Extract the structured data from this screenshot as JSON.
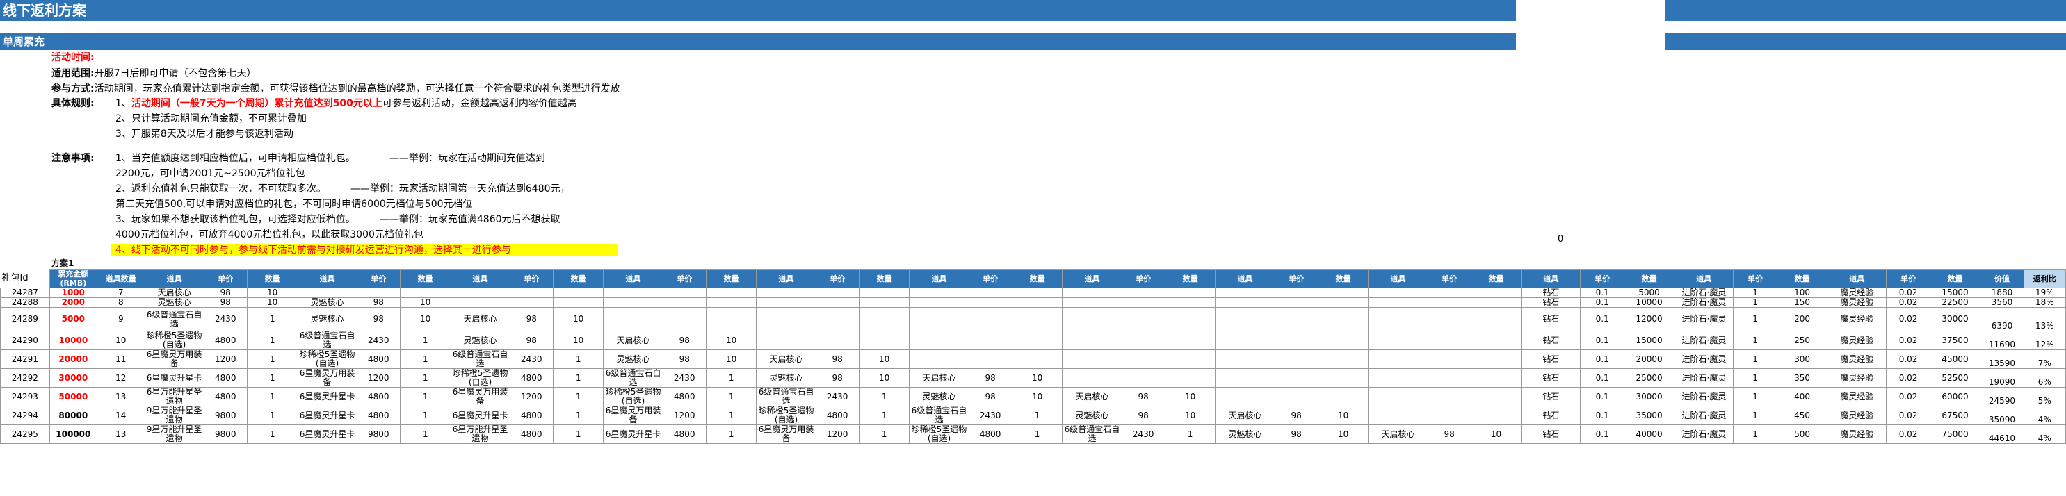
{
  "title": "线下返利方案",
  "subtitle": "单周累充",
  "notes": {
    "time_label": "活动时间:",
    "scope_label": "适用范围:",
    "scope_text": "开服7日后即可申请（不包含第七天）",
    "method_label": "参与方式:",
    "method_text": "活动期间，玩家充值累计达到指定金额，可获得该档位达到的最高档的奖励，可选择任意一个符合要求的礼包类型进行发放",
    "rules_label": "具体规则:",
    "rule1_prefix": "1、",
    "rule1_red": "活动期间（一般7天为一个周期）累计充值达到500元以上",
    "rule1_rest": "可参与返利活动，金额越高返利内容价值越高",
    "rule2": "2、只计算活动期间充值金额，不可累计叠加",
    "rule3": "3、开服第8天及以后才能参与该返利活动",
    "attention_label": "注意事项:",
    "att1a": "1、当充值额度达到相应档位后，可申请相应档位礼包。　　　　——举例：玩家在活动期间充值达到",
    "att1b": "2200元，可申请2001元~2500元档位礼包",
    "att2a": "2、返利充值礼包只能获取一次，不可获取多次。　　　——举例：玩家活动期间第一天充值达到6480元，",
    "att2b": "第二天充值500,可以申请对应档位的礼包，不可同时申请6000元档位与500元档位",
    "att3a": "3、玩家如果不想获取该档位礼包，可选择对应低档位。　　　——举例：玩家充值满4860元后不想获取",
    "att3b": "4000元档位礼包，可放弃4000元档位礼包，以此获取3000元档位礼包",
    "att4": "4、线下活动不可同时参与，参与线下活动前需与对接研发运营进行沟通，选择其一进行参与"
  },
  "stray_zero": "0",
  "plan_label": "方案1",
  "header": {
    "id": "礼包Id",
    "amount": "累充金额(RMB)",
    "count": "道具数量",
    "item": "道具",
    "price": "单价",
    "qty": "数量",
    "value": "价值",
    "ratio": "返利比"
  },
  "rows": [
    {
      "id": "24287",
      "amount": "1000",
      "red": true,
      "count": "7",
      "groups": [
        [
          "天启核心",
          "98",
          "10"
        ],
        [
          "",
          "",
          ""
        ],
        [
          "",
          "",
          ""
        ],
        [
          "",
          "",
          ""
        ],
        [
          "",
          "",
          ""
        ],
        [
          "",
          "",
          ""
        ],
        [
          "",
          "",
          ""
        ],
        [
          "",
          "",
          ""
        ],
        [
          "",
          "",
          ""
        ]
      ],
      "tail": [
        "钻石",
        "0.1",
        "5000",
        "进阶石·魔灵",
        "1",
        "100",
        "魔灵经验",
        "0.02",
        "15000"
      ],
      "value": "1880",
      "ratio": "19%"
    },
    {
      "id": "24288",
      "amount": "2000",
      "red": true,
      "count": "8",
      "groups": [
        [
          "灵魅核心",
          "98",
          "10"
        ],
        [
          "灵魅核心",
          "98",
          "10"
        ],
        [
          "",
          "",
          ""
        ],
        [
          "",
          "",
          ""
        ],
        [
          "",
          "",
          ""
        ],
        [
          "",
          "",
          ""
        ],
        [
          "",
          "",
          ""
        ],
        [
          "",
          "",
          ""
        ],
        [
          "",
          "",
          ""
        ]
      ],
      "tail": [
        "钻石",
        "0.1",
        "10000",
        "进阶石·魔灵",
        "1",
        "150",
        "魔灵经验",
        "0.02",
        "22500"
      ],
      "value": "3560",
      "ratio": "18%"
    },
    {
      "id": "24289",
      "amount": "5000",
      "red": true,
      "count": "9",
      "groups": [
        [
          "6级普通宝石自选",
          "2430",
          "1"
        ],
        [
          "灵魅核心",
          "98",
          "10"
        ],
        [
          "天启核心",
          "98",
          "10"
        ],
        [
          "",
          "",
          ""
        ],
        [
          "",
          "",
          ""
        ],
        [
          "",
          "",
          ""
        ],
        [
          "",
          "",
          ""
        ],
        [
          "",
          "",
          ""
        ],
        [
          "",
          "",
          ""
        ]
      ],
      "tail": [
        "钻石",
        "0.1",
        "12000",
        "进阶石·魔灵",
        "1",
        "200",
        "魔灵经验",
        "0.02",
        "30000"
      ],
      "value": "6390",
      "ratio": "13%"
    },
    {
      "id": "24290",
      "amount": "10000",
      "red": true,
      "count": "10",
      "groups": [
        [
          "珍稀橙5圣遗物(自选)",
          "4800",
          "1"
        ],
        [
          "6级普通宝石自选",
          "2430",
          "1"
        ],
        [
          "灵魅核心",
          "98",
          "10"
        ],
        [
          "天启核心",
          "98",
          "10"
        ],
        [
          "",
          "",
          ""
        ],
        [
          "",
          "",
          ""
        ],
        [
          "",
          "",
          ""
        ],
        [
          "",
          "",
          ""
        ],
        [
          "",
          "",
          ""
        ]
      ],
      "tail": [
        "钻石",
        "0.1",
        "15000",
        "进阶石·魔灵",
        "1",
        "250",
        "魔灵经验",
        "0.02",
        "37500"
      ],
      "value": "11690",
      "ratio": "12%"
    },
    {
      "id": "24291",
      "amount": "20000",
      "red": true,
      "count": "11",
      "groups": [
        [
          "6星魔灵万用装备",
          "1200",
          "1"
        ],
        [
          "珍稀橙5圣遗物(自选)",
          "4800",
          "1"
        ],
        [
          "6级普通宝石自选",
          "2430",
          "1"
        ],
        [
          "灵魅核心",
          "98",
          "10"
        ],
        [
          "天启核心",
          "98",
          "10"
        ],
        [
          "",
          "",
          ""
        ],
        [
          "",
          "",
          ""
        ],
        [
          "",
          "",
          ""
        ],
        [
          "",
          "",
          ""
        ]
      ],
      "tail": [
        "钻石",
        "0.1",
        "20000",
        "进阶石·魔灵",
        "1",
        "300",
        "魔灵经验",
        "0.02",
        "45000"
      ],
      "value": "13590",
      "ratio": "7%"
    },
    {
      "id": "24292",
      "amount": "30000",
      "red": true,
      "count": "12",
      "groups": [
        [
          "6星魔灵升星卡",
          "4800",
          "1"
        ],
        [
          "6星魔灵万用装备",
          "1200",
          "1"
        ],
        [
          "珍稀橙5圣遗物(自选)",
          "4800",
          "1"
        ],
        [
          "6级普通宝石自选",
          "2430",
          "1"
        ],
        [
          "灵魅核心",
          "98",
          "10"
        ],
        [
          "天启核心",
          "98",
          "10"
        ],
        [
          "",
          "",
          ""
        ],
        [
          "",
          "",
          ""
        ],
        [
          "",
          "",
          ""
        ]
      ],
      "tail": [
        "钻石",
        "0.1",
        "25000",
        "进阶石·魔灵",
        "1",
        "350",
        "魔灵经验",
        "0.02",
        "52500"
      ],
      "value": "19090",
      "ratio": "6%"
    },
    {
      "id": "24293",
      "amount": "50000",
      "red": true,
      "count": "13",
      "groups": [
        [
          "6星万能升星圣遗物",
          "4800",
          "1"
        ],
        [
          "6星魔灵升星卡",
          "4800",
          "1"
        ],
        [
          "6星魔灵万用装备",
          "1200",
          "1"
        ],
        [
          "珍稀橙5圣遗物(自选)",
          "4800",
          "1"
        ],
        [
          "6级普通宝石自选",
          "2430",
          "1"
        ],
        [
          "灵魅核心",
          "98",
          "10"
        ],
        [
          "天启核心",
          "98",
          "10"
        ],
        [
          "",
          "",
          ""
        ],
        [
          "",
          "",
          ""
        ]
      ],
      "tail": [
        "钻石",
        "0.1",
        "30000",
        "进阶石·魔灵",
        "1",
        "400",
        "魔灵经验",
        "0.02",
        "60000"
      ],
      "value": "24590",
      "ratio": "5%"
    },
    {
      "id": "24294",
      "amount": "80000",
      "red": false,
      "count": "14",
      "groups": [
        [
          "9星万能升星圣遗物",
          "9800",
          "1"
        ],
        [
          "6星魔灵升星卡",
          "4800",
          "1"
        ],
        [
          "6星魔灵升星卡",
          "4800",
          "1"
        ],
        [
          "6星魔灵万用装备",
          "1200",
          "1"
        ],
        [
          "珍稀橙5圣遗物(自选)",
          "4800",
          "1"
        ],
        [
          "6级普通宝石自选",
          "2430",
          "1"
        ],
        [
          "灵魅核心",
          "98",
          "10"
        ],
        [
          "天启核心",
          "98",
          "10"
        ],
        [
          "",
          "",
          ""
        ]
      ],
      "tail": [
        "钻石",
        "0.1",
        "35000",
        "进阶石·魔灵",
        "1",
        "450",
        "魔灵经验",
        "0.02",
        "67500"
      ],
      "value": "35090",
      "ratio": "4%"
    },
    {
      "id": "24295",
      "amount": "100000",
      "red": false,
      "count": "13",
      "groups": [
        [
          "9星万能升星圣遗物",
          "9800",
          "1"
        ],
        [
          "6星魔灵升星卡",
          "9800",
          "1"
        ],
        [
          "6星万能升星圣遗物",
          "4800",
          "1"
        ],
        [
          "6星魔灵升星卡",
          "4800",
          "1"
        ],
        [
          "6星魔灵万用装备",
          "1200",
          "1"
        ],
        [
          "珍稀橙5圣遗物(自选)",
          "4800",
          "1"
        ],
        [
          "6级普通宝石自选",
          "2430",
          "1"
        ],
        [
          "灵魅核心",
          "98",
          "10"
        ],
        [
          "天启核心",
          "98",
          "10"
        ]
      ],
      "tail": [
        "钻石",
        "0.1",
        "40000",
        "进阶石·魔灵",
        "1",
        "500",
        "魔灵经验",
        "0.02",
        "75000"
      ],
      "value": "44610",
      "ratio": "4%"
    }
  ]
}
